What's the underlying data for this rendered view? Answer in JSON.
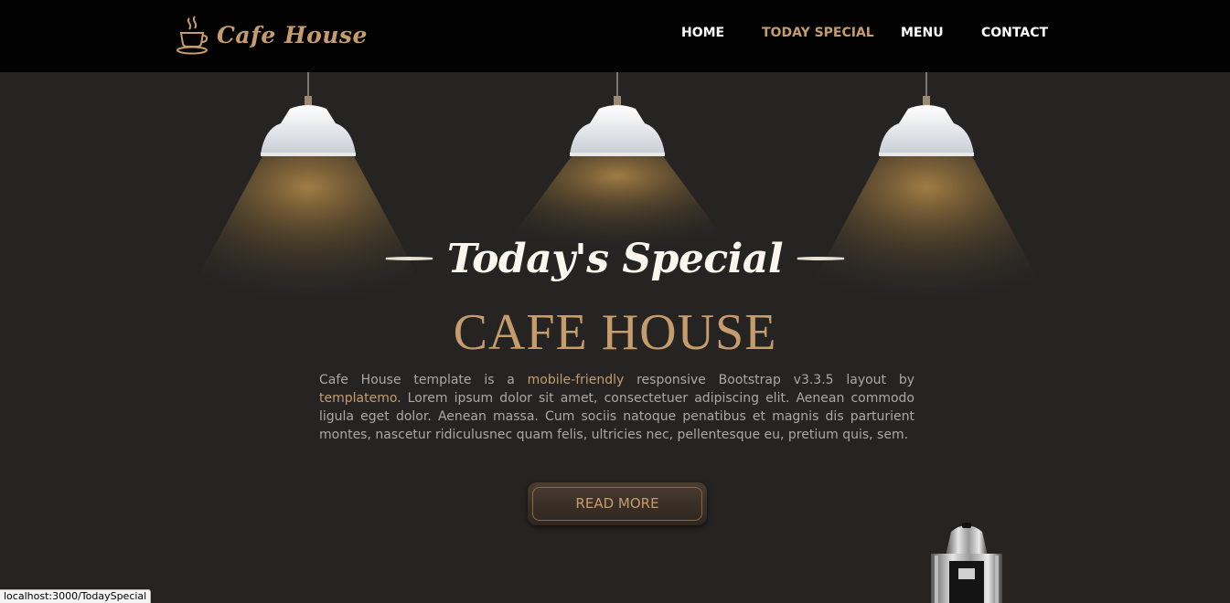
{
  "brand": {
    "name": "Cafe House",
    "icon": "coffee-cup-icon"
  },
  "nav": {
    "items": [
      {
        "label": "HOME",
        "active": false
      },
      {
        "label": "TODAY SPECIAL",
        "active": true
      },
      {
        "label": "MENU",
        "active": false
      },
      {
        "label": "CONTACT",
        "active": false
      }
    ]
  },
  "hero": {
    "subtitle": "Today's Special",
    "heading": "CAFE HOUSE",
    "paragraph": {
      "part1": "Cafe House template is a ",
      "link1": "mobile-friendly",
      "part2": " responsive Bootstrap v3.3.5 layout by ",
      "link2": "templatemo",
      "part3": ". Lorem ipsum dolor sit amet, consectetuer adipiscing elit. Aenean commodo ligula eget dolor. Aenean massa. Cum sociis natoque penatibus et magnis dis parturient montes, nascetur ridiculusnec quam felis, ultricies nec, pellentesque eu, pretium quis, sem."
    },
    "button_label": "READ MORE"
  },
  "status_bar": {
    "url": "localhost:3000/TodaySpecial"
  },
  "colors": {
    "accent": "#c69c6d",
    "background": "#252423",
    "header": "#020202",
    "text": "#a9a9a9"
  }
}
